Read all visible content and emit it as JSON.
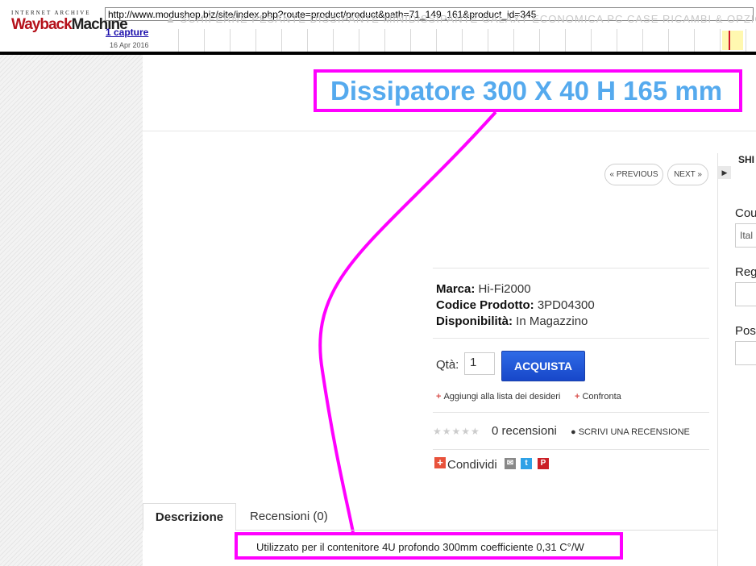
{
  "wayback": {
    "logo_top": "INTERNET ARCHIVE",
    "logo_main_a": "Wayback",
    "logo_main_b": "Machine",
    "url": "http://www.modushop.biz/site/index.php?route=product/product&path=71_149_161&product_id=345",
    "captures": "1 capture",
    "date": "16 Apr 2016",
    "ghost_menu": "▲   SCHIFERNE    PESANTE    DISSIPANTE    MINIDISSIPANTE    GALAXY    ECONOMICA    PC CASE    RICAMBI & OPZIONI"
  },
  "product": {
    "title": "Dissipatore 300 X 40 H 165 mm",
    "prev_label": "« PREVIOUS",
    "next_label": "NEXT »",
    "brand_label": "Marca:",
    "brand_value": "Hi-Fi2000",
    "code_label": "Codice Prodotto:",
    "code_value": "3PD04300",
    "avail_label": "Disponibilità:",
    "avail_value": "In Magazzino",
    "qty_label": "Qtà:",
    "qty_value": "1",
    "buy_label": "ACQUISTA",
    "wishlist_label": "Aggiungi alla lista dei desideri",
    "compare_label": "Confronta",
    "stars": "★★★★★",
    "reviews_label": "0 recensioni",
    "write_review_label": "SCRIVI UNA RECENSIONE",
    "share_label": "Condividi"
  },
  "shipping": {
    "heading": "SHI",
    "country_label": "Cou",
    "country_value": "Ital",
    "region_label": "Reg",
    "postcode_label": "Pos"
  },
  "tabs": {
    "description": "Descrizione",
    "reviews": "Recensioni (0)"
  },
  "description_text": "Utilizzato per il contenitore 4U profondo 300mm coefficiente 0,31 C°/W",
  "colors": {
    "title": "#55aaee",
    "highlight": "#ff00ff",
    "buy_button": "#1f55d6"
  }
}
